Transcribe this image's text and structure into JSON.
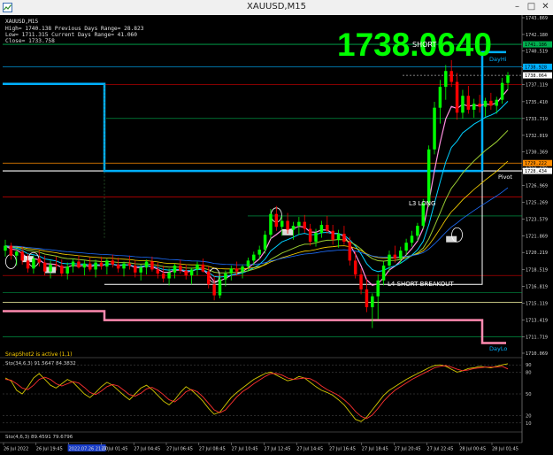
{
  "window": {
    "title": "XAUUSD,M15",
    "controls": [
      "minimize-icon",
      "maximize-icon",
      "close-icon"
    ]
  },
  "info": {
    "symbol": "XAUUSD,M15",
    "line1": "High= 1740.138    Previous Days Range= 28.823",
    "line2": "Low= 1711.315    Current Days Range= 41.060",
    "line3": "Close= 1733.758"
  },
  "big_price": "1738.0640",
  "labels": {
    "short_top": "SHORT",
    "pivot": "Pivot",
    "day_hi": "DayHi",
    "day_lo": "DayLo",
    "l3_long": "L3 LONG",
    "l4_short_breakout": "L4 SHORT BREAKOUT",
    "snapshot": "SnapShot2 is active (1,1)"
  },
  "indicators": {
    "stoch1": "Sto(34,6,3) 91.5647 84.3832",
    "stoch2": "Sto(4,6,3) 89.4591 79.6796"
  },
  "colors": {
    "background": "#000000",
    "bull_candle": "#00ff00",
    "bear_candle": "#ff0000",
    "big_price": "#00ff00",
    "pivot_line": "#ffffff",
    "day_range_line": "#00b0ff",
    "stoch_main": "#d4c800",
    "stoch_signal": "#ff3030"
  },
  "chart_data": {
    "type": "candlestick",
    "symbol": "XAUUSD",
    "timeframe": "M15",
    "ylim": [
      1710.069,
      1743.869
    ],
    "y_ticks": [
      1743.869,
      1742.18,
      1740.519,
      1738.808,
      1737.119,
      1735.41,
      1733.719,
      1732.019,
      1730.369,
      1728.679,
      1726.969,
      1725.269,
      1723.579,
      1721.869,
      1720.219,
      1718.519,
      1716.819,
      1715.119,
      1713.419,
      1711.719,
      1710.069
    ],
    "price_tags": [
      {
        "value": 1741.186,
        "color": "#00b050"
      },
      {
        "value": 1738.928,
        "color": "#00b0ff"
      },
      {
        "value": 1738.064,
        "color": "#ffffff"
      },
      {
        "value": 1729.222,
        "color": "#ff8c00"
      },
      {
        "value": 1728.434,
        "color": "#ffffff"
      }
    ],
    "x_labels": [
      "26 Jul 2022",
      "26 Jul 19:45",
      "2022.07.26 21:00",
      "27 Jul 01:45",
      "27 Jul 04:45",
      "27 Jul 06:45",
      "27 Jul 08:45",
      "27 Jul 10:45",
      "27 Jul 12:45",
      "27 Jul 14:45",
      "27 Jul 16:45",
      "27 Jul 18:45",
      "27 Jul 20:45",
      "27 Jul 22:45",
      "28 Jul 00:45",
      "28 Jul 01:45"
    ],
    "levels": [
      {
        "name": "Pivot",
        "value": 1728.434,
        "color": "#ffffff"
      },
      {
        "name": "DayHi",
        "value": 1740.4,
        "color": "#00b0ff"
      },
      {
        "name": "DayLo",
        "value": 1711.0,
        "color": "#ff8ab0"
      },
      {
        "name": "R-level",
        "value": 1741.186,
        "color": "#00b050"
      },
      {
        "name": "S-level",
        "value": 1729.222,
        "color": "#ff8c00"
      },
      {
        "name": "red-level",
        "value": 1725.8,
        "color": "#d40000"
      },
      {
        "name": "magenta-level",
        "value": 1717.9,
        "color": "#d40000"
      }
    ],
    "candles": [
      [
        1720.4,
        1721.5,
        1719.8,
        1720.9
      ],
      [
        1720.9,
        1721.2,
        1719.5,
        1719.9
      ],
      [
        1719.9,
        1720.6,
        1718.9,
        1720.3
      ],
      [
        1720.3,
        1720.8,
        1719.0,
        1719.4
      ],
      [
        1719.4,
        1720.1,
        1718.2,
        1718.6
      ],
      [
        1718.6,
        1719.9,
        1718.1,
        1719.6
      ],
      [
        1719.6,
        1720.4,
        1718.8,
        1719.2
      ],
      [
        1719.2,
        1719.9,
        1717.9,
        1718.3
      ],
      [
        1718.3,
        1719.4,
        1717.6,
        1719.0
      ],
      [
        1719.0,
        1719.8,
        1718.4,
        1718.9
      ],
      [
        1718.9,
        1719.5,
        1717.8,
        1718.1
      ],
      [
        1718.1,
        1719.2,
        1717.5,
        1718.8
      ],
      [
        1718.8,
        1719.6,
        1718.2,
        1719.3
      ],
      [
        1719.3,
        1719.9,
        1718.6,
        1718.7
      ],
      [
        1718.7,
        1719.4,
        1717.9,
        1719.1
      ],
      [
        1719.1,
        1719.7,
        1718.3,
        1718.5
      ],
      [
        1718.5,
        1719.5,
        1717.7,
        1719.2
      ],
      [
        1719.2,
        1719.8,
        1718.5,
        1718.8
      ],
      [
        1718.8,
        1719.6,
        1718.0,
        1719.4
      ],
      [
        1719.4,
        1720.0,
        1718.7,
        1719.0
      ],
      [
        1719.0,
        1719.7,
        1718.2,
        1718.6
      ],
      [
        1718.6,
        1719.3,
        1717.8,
        1719.1
      ],
      [
        1719.1,
        1719.9,
        1718.5,
        1718.9
      ],
      [
        1718.9,
        1719.4,
        1717.7,
        1718.2
      ],
      [
        1718.2,
        1719.0,
        1717.4,
        1718.7
      ],
      [
        1718.7,
        1719.5,
        1718.0,
        1719.3
      ],
      [
        1719.3,
        1719.8,
        1718.3,
        1718.5
      ],
      [
        1718.5,
        1719.2,
        1717.6,
        1718.1
      ],
      [
        1718.1,
        1718.9,
        1717.2,
        1717.6
      ],
      [
        1717.6,
        1718.6,
        1716.9,
        1718.2
      ],
      [
        1718.2,
        1719.1,
        1717.6,
        1718.9
      ],
      [
        1718.9,
        1719.5,
        1718.1,
        1718.4
      ],
      [
        1718.4,
        1719.0,
        1717.5,
        1717.9
      ],
      [
        1717.9,
        1718.7,
        1717.0,
        1718.5
      ],
      [
        1718.5,
        1719.3,
        1717.9,
        1719.0
      ],
      [
        1719.0,
        1719.6,
        1718.2,
        1718.3
      ],
      [
        1718.3,
        1718.8,
        1716.6,
        1717.0
      ],
      [
        1717.0,
        1717.8,
        1715.4,
        1715.9
      ],
      [
        1715.9,
        1717.9,
        1715.6,
        1717.5
      ],
      [
        1717.5,
        1718.4,
        1716.8,
        1718.1
      ],
      [
        1718.1,
        1718.9,
        1717.4,
        1718.6
      ],
      [
        1718.6,
        1719.3,
        1717.9,
        1718.3
      ],
      [
        1718.3,
        1719.0,
        1717.6,
        1718.8
      ],
      [
        1718.8,
        1719.7,
        1718.3,
        1719.4
      ],
      [
        1719.4,
        1720.3,
        1718.9,
        1720.0
      ],
      [
        1720.0,
        1720.9,
        1719.5,
        1720.5
      ],
      [
        1720.5,
        1722.4,
        1720.1,
        1722.0
      ],
      [
        1722.0,
        1724.6,
        1721.6,
        1724.1
      ],
      [
        1724.1,
        1724.9,
        1722.4,
        1722.8
      ],
      [
        1722.8,
        1723.9,
        1721.9,
        1723.4
      ],
      [
        1723.4,
        1724.2,
        1722.1,
        1722.5
      ],
      [
        1722.5,
        1723.3,
        1721.5,
        1722.9
      ],
      [
        1722.9,
        1723.8,
        1722.0,
        1723.3
      ],
      [
        1723.3,
        1724.0,
        1722.2,
        1722.6
      ],
      [
        1722.6,
        1723.1,
        1720.9,
        1721.3
      ],
      [
        1721.3,
        1722.6,
        1720.8,
        1722.2
      ],
      [
        1722.2,
        1723.4,
        1721.7,
        1723.0
      ],
      [
        1723.0,
        1723.9,
        1722.1,
        1722.4
      ],
      [
        1722.4,
        1723.0,
        1721.0,
        1721.5
      ],
      [
        1721.5,
        1722.5,
        1720.7,
        1722.1
      ],
      [
        1722.1,
        1722.9,
        1721.0,
        1721.3
      ],
      [
        1721.3,
        1721.8,
        1718.9,
        1719.4
      ],
      [
        1719.4,
        1720.3,
        1717.6,
        1718.0
      ],
      [
        1718.0,
        1718.6,
        1716.0,
        1716.5
      ],
      [
        1716.5,
        1717.6,
        1714.2,
        1714.7
      ],
      [
        1714.7,
        1716.1,
        1712.6,
        1715.8
      ],
      [
        1715.8,
        1718.0,
        1713.5,
        1717.4
      ],
      [
        1717.4,
        1719.3,
        1716.9,
        1718.9
      ],
      [
        1718.9,
        1720.4,
        1718.3,
        1720.0
      ],
      [
        1720.0,
        1720.9,
        1719.2,
        1719.6
      ],
      [
        1719.6,
        1720.8,
        1719.1,
        1720.4
      ],
      [
        1720.4,
        1721.6,
        1719.9,
        1721.2
      ],
      [
        1721.2,
        1722.4,
        1720.8,
        1721.9
      ],
      [
        1721.9,
        1723.2,
        1721.4,
        1722.9
      ],
      [
        1722.9,
        1725.6,
        1722.6,
        1725.2
      ],
      [
        1725.2,
        1731.0,
        1724.8,
        1730.6
      ],
      [
        1730.6,
        1735.4,
        1730.1,
        1734.8
      ],
      [
        1734.8,
        1737.6,
        1733.2,
        1736.9
      ],
      [
        1736.9,
        1739.1,
        1735.6,
        1738.5
      ],
      [
        1738.5,
        1739.6,
        1736.9,
        1737.4
      ],
      [
        1737.4,
        1738.3,
        1733.6,
        1734.3
      ],
      [
        1734.3,
        1736.6,
        1733.7,
        1736.0
      ],
      [
        1736.0,
        1737.0,
        1734.2,
        1734.6
      ],
      [
        1734.6,
        1735.7,
        1733.8,
        1735.2
      ],
      [
        1735.2,
        1736.1,
        1734.3,
        1734.9
      ],
      [
        1734.9,
        1735.8,
        1733.9,
        1735.5
      ],
      [
        1735.5,
        1736.3,
        1734.6,
        1735.0
      ],
      [
        1735.0,
        1735.9,
        1734.2,
        1735.6
      ],
      [
        1735.6,
        1737.8,
        1735.2,
        1737.3
      ],
      [
        1737.3,
        1738.4,
        1736.6,
        1738.06
      ]
    ],
    "stochastic": [
      {
        "name": "Sto(34,6,3) main",
        "values": [
          72,
          68,
          55,
          50,
          60,
          72,
          78,
          70,
          62,
          58,
          64,
          70,
          66,
          58,
          50,
          45,
          52,
          60,
          66,
          62,
          55,
          48,
          42,
          50,
          58,
          62,
          56,
          48,
          40,
          35,
          42,
          52,
          60,
          55,
          48,
          40,
          30,
          22,
          25,
          35,
          45,
          52,
          58,
          64,
          70,
          74,
          78,
          80,
          76,
          72,
          68,
          70,
          74,
          72,
          66,
          60,
          55,
          52,
          48,
          42,
          35,
          25,
          15,
          12,
          18,
          28,
          38,
          48,
          55,
          60,
          65,
          70,
          74,
          78,
          82,
          86,
          89,
          90,
          88,
          84,
          80,
          82,
          85,
          86,
          88,
          87,
          86,
          88,
          90,
          91.56
        ]
      },
      {
        "name": "Sto(34,6,3) signal",
        "values": [
          70,
          69,
          64,
          58,
          56,
          62,
          70,
          73,
          70,
          64,
          61,
          64,
          67,
          65,
          59,
          52,
          49,
          54,
          60,
          63,
          61,
          55,
          49,
          47,
          51,
          57,
          59,
          55,
          49,
          42,
          39,
          45,
          53,
          56,
          53,
          46,
          37,
          28,
          24,
          28,
          37,
          46,
          53,
          58,
          64,
          69,
          74,
          78,
          78,
          76,
          72,
          70,
          71,
          72,
          71,
          67,
          61,
          56,
          52,
          48,
          42,
          35,
          26,
          19,
          16,
          21,
          30,
          40,
          48,
          55,
          60,
          65,
          70,
          74,
          78,
          82,
          86,
          88,
          89,
          87,
          84,
          82,
          83,
          85,
          86,
          87,
          87,
          87,
          88,
          84.38
        ]
      }
    ],
    "stoch_levels": [
      90,
      80,
      50,
      20,
      10
    ],
    "stoch_ylim": [
      0,
      100
    ]
  }
}
